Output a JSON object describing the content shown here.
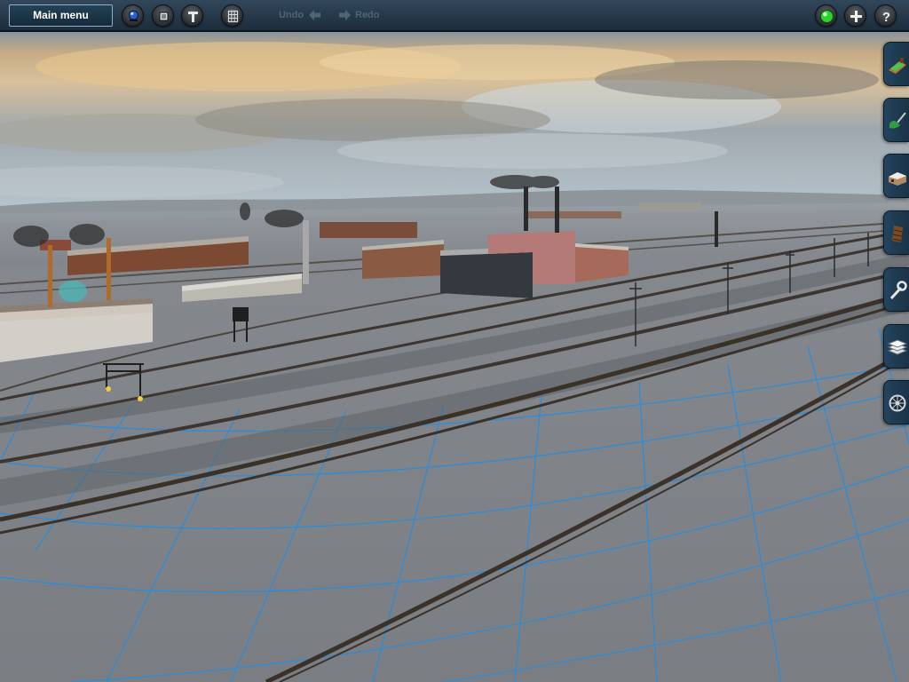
{
  "toolbar": {
    "main_menu_label": "Main menu",
    "undo_label": "Undo",
    "redo_label": "Redo",
    "left_buttons": [
      "driver-mode-icon",
      "stop-icon",
      "info-icon",
      "grid-icon"
    ],
    "right_buttons": [
      "status-light-icon",
      "add-icon",
      "help-icon"
    ]
  },
  "tools": [
    "track-tool-icon",
    "paint-tool-icon",
    "building-tool-icon",
    "bridge-tool-icon",
    "edit-tool-icon",
    "layers-tool-icon",
    "settings-tool-icon"
  ],
  "colors": {
    "toolbar_bg": "#22374a",
    "grid_line": "#1c8fe8",
    "status_light": "#2fd12f"
  }
}
